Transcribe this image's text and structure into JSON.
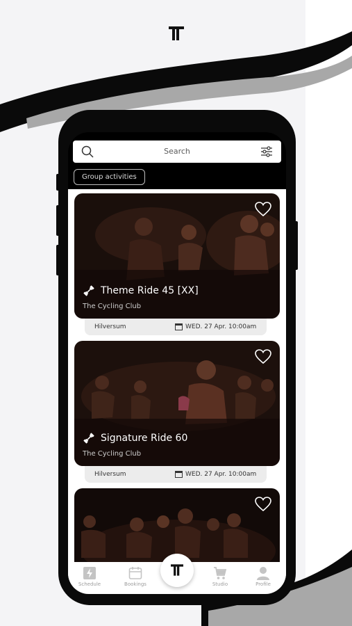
{
  "search": {
    "placeholder": "Search"
  },
  "filter_chip": {
    "label": "Group activities"
  },
  "classes": [
    {
      "title": "Theme Ride 45 [XX]",
      "studio": "The Cycling Club",
      "location": "Hilversum",
      "date": "WED. 27 Apr. 10:00am"
    },
    {
      "title": "Signature Ride 60",
      "studio": "The Cycling Club",
      "location": "Hilversum",
      "date": "WED. 27 Apr. 10:00am"
    },
    {
      "title": "",
      "studio": "",
      "location": "",
      "date": ""
    }
  ],
  "tabs": [
    {
      "label": "Schedule",
      "icon": "lightning-icon"
    },
    {
      "label": "Bookings",
      "icon": "calendar-icon"
    },
    {
      "label": "",
      "icon": "brand-logo-icon"
    },
    {
      "label": "Studio",
      "icon": "cart-icon"
    },
    {
      "label": "Profile",
      "icon": "person-icon"
    }
  ],
  "colors": {
    "dark": "#0a0a0a",
    "card_overlay": "#2a1610",
    "strip": "#ececec",
    "accent_grey": "#9a9a9a"
  }
}
